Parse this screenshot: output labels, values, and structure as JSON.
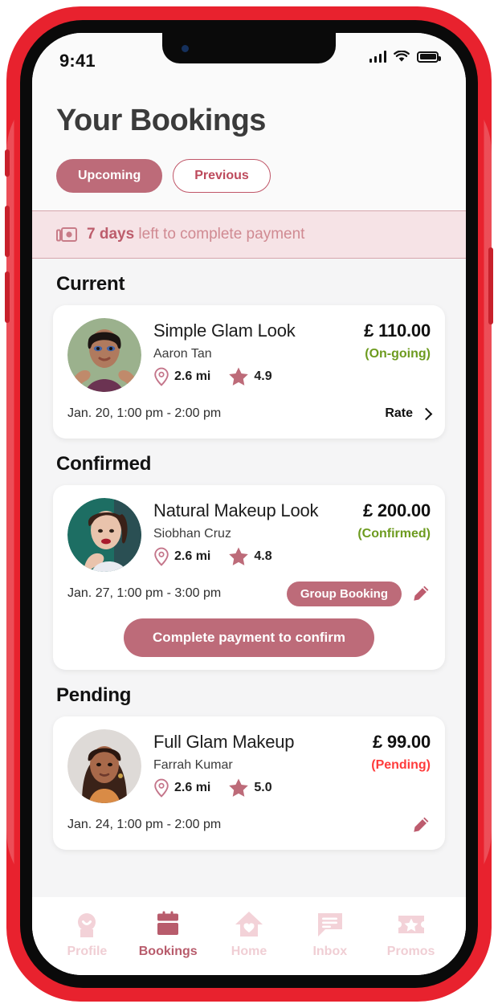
{
  "status_bar": {
    "time": "9:41",
    "icons": [
      "signal-bars-icon",
      "wifi-icon",
      "battery-icon"
    ]
  },
  "header": {
    "title": "Your Bookings",
    "tabs": [
      {
        "label": "Upcoming",
        "active": true
      },
      {
        "label": "Previous",
        "active": false
      }
    ]
  },
  "payment_banner": {
    "icon": "cash-icon",
    "highlight": "7 days",
    "text": " left to complete payment"
  },
  "sections": [
    {
      "title": "Current",
      "booking": {
        "service": "Simple Glam Look",
        "artist": "Aaron Tan",
        "distance": "2.6 mi",
        "rating": "4.9",
        "price": "£ 110.00",
        "status": "(On-going)",
        "status_color": "#6d9b1f",
        "datetime": "Jan. 20, 1:00 pm - 2:00 pm",
        "action_label": "Rate",
        "avatar_bg": "#9bb18d"
      }
    },
    {
      "title": "Confirmed",
      "booking": {
        "service": "Natural Makeup Look",
        "artist": "Siobhan Cruz",
        "distance": "2.6 mi",
        "rating": "4.8",
        "price": "£ 200.00",
        "status": "(Confirmed)",
        "status_color": "#6d9b1f",
        "datetime": "Jan. 27, 1:00 pm - 3:00 pm",
        "tag_label": "Group Booking",
        "cta_label": "Complete payment to confirm",
        "avatar_bg": "#1d6e63"
      }
    },
    {
      "title": "Pending",
      "booking": {
        "service": "Full Glam Makeup",
        "artist": "Farrah Kumar",
        "distance": "2.6 mi",
        "rating": "5.0",
        "price": "£ 99.00",
        "status": "(Pending)",
        "status_color": "#ff3b3b",
        "datetime": "Jan. 24, 1:00 pm - 2:00 pm",
        "avatar_bg": "#dedad7"
      }
    }
  ],
  "bottom_nav": [
    {
      "label": "Profile",
      "icon": "profile-icon",
      "active": false
    },
    {
      "label": "Bookings",
      "icon": "calendar-icon",
      "active": true
    },
    {
      "label": "Home",
      "icon": "home-heart-icon",
      "active": false
    },
    {
      "label": "Inbox",
      "icon": "chat-icon",
      "active": false
    },
    {
      "label": "Promos",
      "icon": "ticket-star-icon",
      "active": false
    }
  ],
  "colors": {
    "brand_rose": "#bd6b79",
    "brand_rose_dark": "#b85c6c",
    "nav_idle": "#f0ced4",
    "banner_bg": "#f6e3e6",
    "page_bg": "#f5f5f6",
    "frame_red": "#e8222e"
  }
}
